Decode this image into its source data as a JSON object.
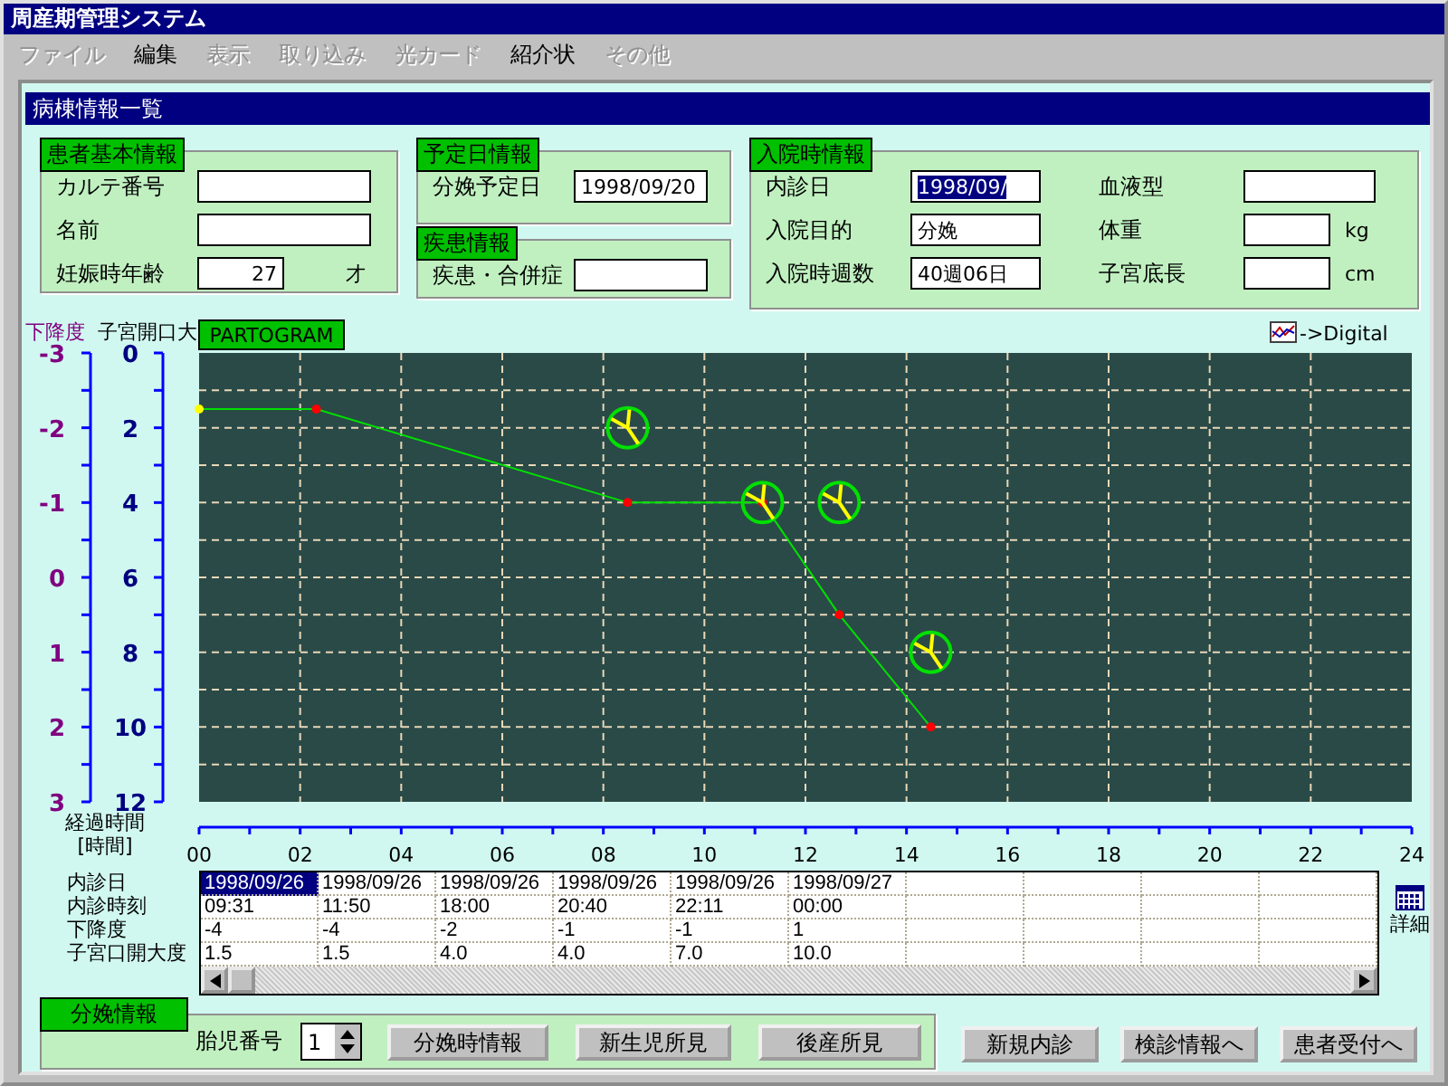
{
  "window": {
    "title": "周産期管理システム"
  },
  "menu": [
    {
      "label": "ファイル",
      "disabled": true
    },
    {
      "label": "編集",
      "disabled": false
    },
    {
      "label": "表示",
      "disabled": true
    },
    {
      "label": "取り込み",
      "disabled": true
    },
    {
      "label": "光カード",
      "disabled": true
    },
    {
      "label": "紹介状",
      "disabled": false
    },
    {
      "label": "その他",
      "disabled": true
    }
  ],
  "panel": {
    "title": "病棟情報一覧"
  },
  "patient_info": {
    "title": "患者基本情報",
    "fields": [
      {
        "label": "カルテ番号"
      },
      {
        "label": "名前"
      },
      {
        "label": "妊娠時年齢",
        "value": "27",
        "unit": "才"
      }
    ]
  },
  "due_date": {
    "title": "予定日情報",
    "fields": [
      {
        "label": "分娩予定日",
        "value": "1998/09/20"
      }
    ]
  },
  "disease": {
    "title": "疾患情報",
    "fields": [
      {
        "label": "疾患・合併症"
      }
    ]
  },
  "admission": {
    "title": "入院時情報",
    "fields": [
      {
        "label": "内診日",
        "value": "1998/09/",
        "selected": true
      },
      {
        "label": "血液型",
        "selected": false
      },
      {
        "label": "入院目的",
        "value": "分娩",
        "selected": false
      },
      {
        "label": "体重",
        "unit": "kg",
        "selected": false
      },
      {
        "label": "入院時週数",
        "value": "40週06日",
        "selected": false
      },
      {
        "label": "子宮底長",
        "unit": "cm",
        "selected": false
      }
    ]
  },
  "partogram": {
    "badge": "PARTOGRAM",
    "digital_link": "->Digital",
    "descent_axis": {
      "title": "下降度",
      "ticks": [
        "-3",
        "-2",
        "-1",
        "0",
        "1",
        "2",
        "3"
      ]
    },
    "time_unit": "[時間]",
    "chart_data": {
      "type": "line",
      "ylabel": "子宮開口大",
      "xlabel": "経過時間",
      "grid": true,
      "x": [
        0,
        2.32,
        8.48,
        11.15,
        12.67,
        14.48
      ],
      "xlim": [
        0,
        24
      ],
      "ylim": [
        12,
        0
      ],
      "xticks": [
        {
          "value": 0,
          "label": "00"
        },
        {
          "value": 2,
          "label": "02"
        },
        {
          "value": 4,
          "label": "04"
        },
        {
          "value": 6,
          "label": "06"
        },
        {
          "value": 8,
          "label": "08"
        },
        {
          "value": 10,
          "label": "10"
        },
        {
          "value": 12,
          "label": "12"
        },
        {
          "value": 14,
          "label": "14"
        },
        {
          "value": 16,
          "label": "16"
        },
        {
          "value": 18,
          "label": "18"
        },
        {
          "value": 20,
          "label": "20"
        },
        {
          "value": 22,
          "label": "22"
        },
        {
          "value": 24,
          "label": "24"
        }
      ],
      "yticks": [
        0,
        2,
        4,
        6,
        8,
        10,
        12
      ],
      "series": [
        {
          "color": "#00e000",
          "marker": "circle",
          "values": [
            1.5,
            1.5,
            4,
            4,
            7,
            10
          ]
        }
      ]
    }
  },
  "table": {
    "row_labels": [
      "内診日",
      "内診時刻",
      "下降度",
      "子宮口開大度"
    ],
    "visits": [
      {
        "date": "1998/09/26",
        "time": "09:31",
        "descent": "-4",
        "dilation": "1.5",
        "selected": true
      },
      {
        "date": "1998/09/26",
        "time": "11:50",
        "descent": "-4",
        "dilation": "1.5",
        "selected": false
      },
      {
        "date": "1998/09/26",
        "time": "18:00",
        "descent": "-2",
        "dilation": "4.0",
        "selected": false
      },
      {
        "date": "1998/09/26",
        "time": "20:40",
        "descent": "-1",
        "dilation": "4.0",
        "selected": false
      },
      {
        "date": "1998/09/26",
        "time": "22:11",
        "descent": "-1",
        "dilation": "7.0",
        "selected": false
      },
      {
        "date": "1998/09/27",
        "time": "00:00",
        "descent": "1",
        "dilation": "10.0",
        "selected": false
      }
    ],
    "detail_button": "詳細"
  },
  "delivery": {
    "title": "分娩情報",
    "fetus_label": "胎児番号",
    "fetus_number": "1",
    "buttons": [
      "分娩時情報",
      "新生児所見",
      "後産所見"
    ]
  },
  "actions": [
    "新規内診",
    "検診情報へ",
    "患者受付へ"
  ]
}
